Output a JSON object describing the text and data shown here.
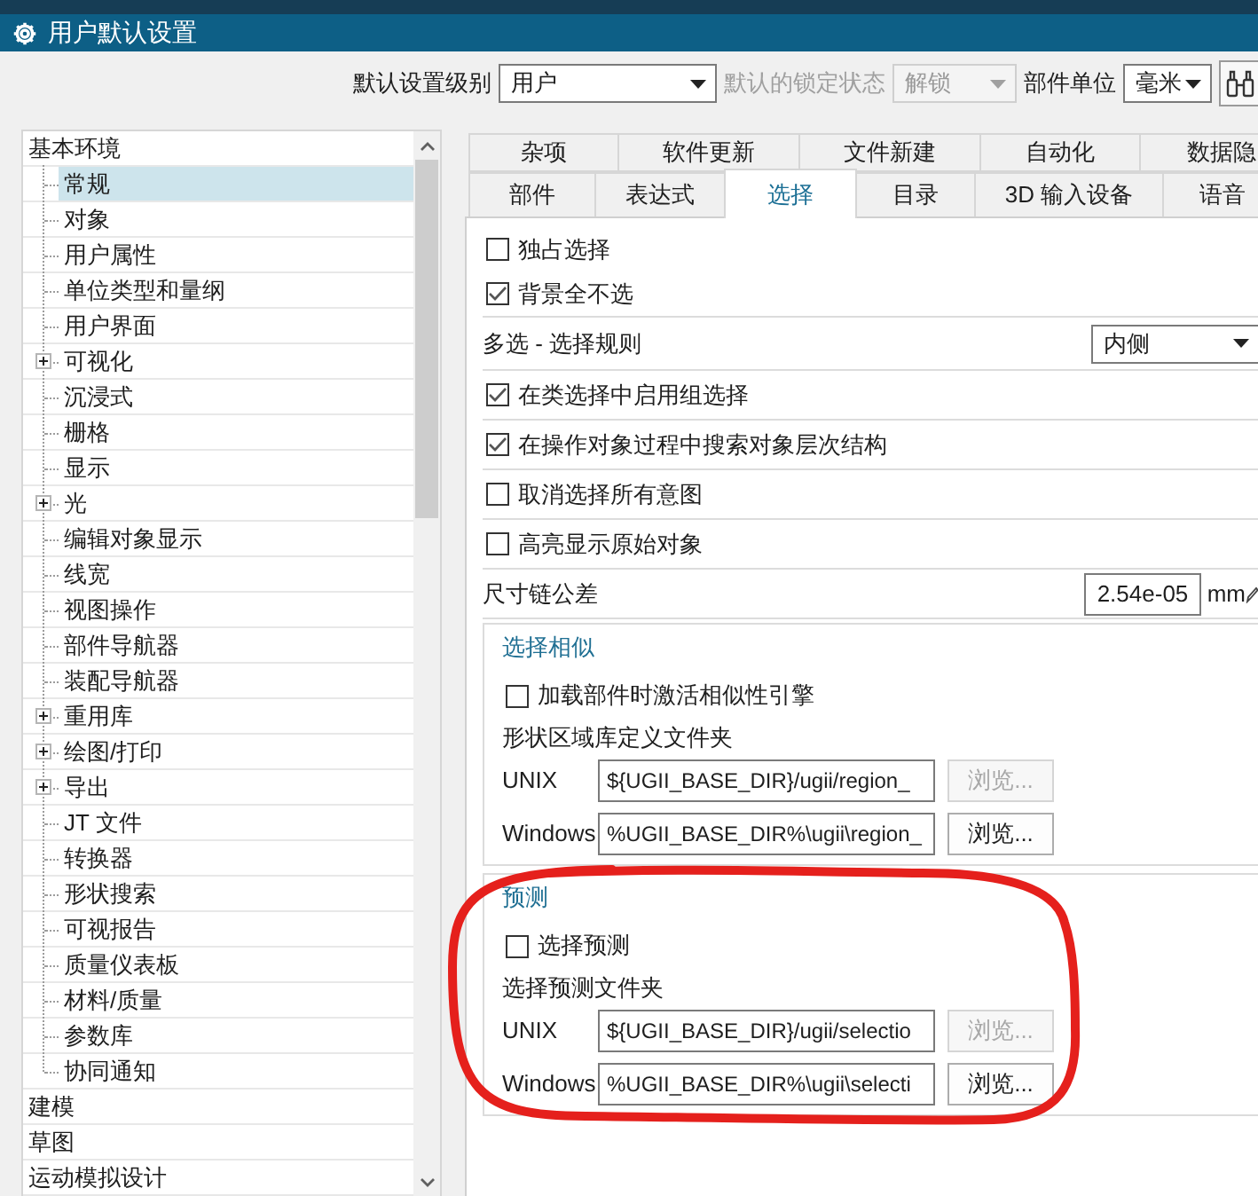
{
  "window": {
    "title": "用户默认设置"
  },
  "settings_bar": {
    "fields": [
      {
        "label": "默认设置级别",
        "value": "用户",
        "disabled": false
      },
      {
        "label": "默认的锁定状态",
        "value": "解锁",
        "disabled": true
      },
      {
        "label": "部件单位",
        "value": "毫米",
        "disabled": false
      }
    ]
  },
  "tree": {
    "items": [
      {
        "label": "基本环境",
        "selected": false,
        "children": [
          {
            "label": "常规",
            "selected": true
          },
          {
            "label": "对象",
            "selected": false
          },
          {
            "label": "用户属性",
            "selected": false
          },
          {
            "label": "单位类型和量纲",
            "selected": false
          },
          {
            "label": "用户界面",
            "selected": false
          },
          {
            "label": "可视化",
            "selected": false,
            "expanded": false
          },
          {
            "label": "沉浸式",
            "selected": false
          },
          {
            "label": "栅格",
            "selected": false
          },
          {
            "label": "显示",
            "selected": false
          },
          {
            "label": "光",
            "selected": false,
            "expanded": false
          },
          {
            "label": "编辑对象显示",
            "selected": false
          },
          {
            "label": "线宽",
            "selected": false
          },
          {
            "label": "视图操作",
            "selected": false
          },
          {
            "label": "部件导航器",
            "selected": false
          },
          {
            "label": "装配导航器",
            "selected": false
          },
          {
            "label": "重用库",
            "selected": false,
            "expanded": false
          },
          {
            "label": "绘图/打印",
            "selected": false,
            "expanded": false
          },
          {
            "label": "导出",
            "selected": false,
            "expanded": false
          },
          {
            "label": "JT 文件",
            "selected": false
          },
          {
            "label": "转换器",
            "selected": false
          },
          {
            "label": "形状搜索",
            "selected": false
          },
          {
            "label": "可视报告",
            "selected": false
          },
          {
            "label": "质量仪表板",
            "selected": false
          },
          {
            "label": "材料/质量",
            "selected": false
          },
          {
            "label": "参数库",
            "selected": false
          },
          {
            "label": "协同通知",
            "selected": false
          }
        ]
      },
      {
        "label": "建模",
        "selected": false
      },
      {
        "label": "草图",
        "selected": false
      },
      {
        "label": "运动模拟设计",
        "selected": false
      }
    ]
  },
  "tabs": {
    "rows": [
      {
        "tabs": [
          {
            "label": "杂项",
            "selected": false
          },
          {
            "label": "软件更新",
            "selected": false
          },
          {
            "label": "文件新建",
            "selected": false
          },
          {
            "label": "自动化",
            "selected": false
          },
          {
            "label": "数据隐",
            "selected": false
          }
        ]
      },
      {
        "tabs": [
          {
            "label": "部件",
            "selected": false
          },
          {
            "label": "表达式",
            "selected": false
          },
          {
            "label": "选择",
            "selected": true
          },
          {
            "label": "目录",
            "selected": false
          },
          {
            "label": "3D 输入设备",
            "selected": false
          },
          {
            "label": "语音",
            "selected": false
          }
        ]
      }
    ]
  },
  "options": [
    {
      "kind": "checkbox",
      "label": "独占选择",
      "checked": false
    },
    {
      "kind": "checkbox",
      "label": "背景全不选",
      "checked": true
    },
    {
      "kind": "dropdown",
      "label": "多选 - 选择规则",
      "value": "内侧"
    },
    {
      "kind": "checkbox",
      "label": "在类选择中启用组选择",
      "checked": true
    },
    {
      "kind": "checkbox",
      "label": "在操作对象过程中搜索对象层次结构",
      "checked": true
    },
    {
      "kind": "checkbox",
      "label": "取消选择所有意图",
      "checked": false
    },
    {
      "kind": "checkbox",
      "label": "高亮显示原始对象",
      "checked": false
    },
    {
      "kind": "number",
      "label": "尺寸链公差",
      "value": "2.54e-05",
      "unit": "mm"
    }
  ],
  "groups": [
    {
      "title": "选择相似",
      "checkbox": {
        "label": "加载部件时激活相似性引擎",
        "checked": false
      },
      "folder_label": "形状区域库定义文件夹",
      "paths": [
        {
          "platform": "UNIX",
          "value": "${UGII_BASE_DIR}/ugii/region_",
          "browse": {
            "label": "浏览...",
            "disabled": true
          }
        },
        {
          "platform": "Windows",
          "value": "%UGII_BASE_DIR%\\ugii\\region_",
          "browse": {
            "label": "浏览...",
            "disabled": false
          }
        }
      ]
    },
    {
      "title": "预测",
      "checkbox": {
        "label": "选择预测",
        "checked": false
      },
      "folder_label": "选择预测文件夹",
      "paths": [
        {
          "platform": "UNIX",
          "value": "${UGII_BASE_DIR}/ugii/selectio",
          "browse": {
            "label": "浏览...",
            "disabled": true
          }
        },
        {
          "platform": "Windows",
          "value": "%UGII_BASE_DIR%\\ugii\\selecti",
          "browse": {
            "label": "浏览...",
            "disabled": false
          }
        }
      ]
    }
  ]
}
